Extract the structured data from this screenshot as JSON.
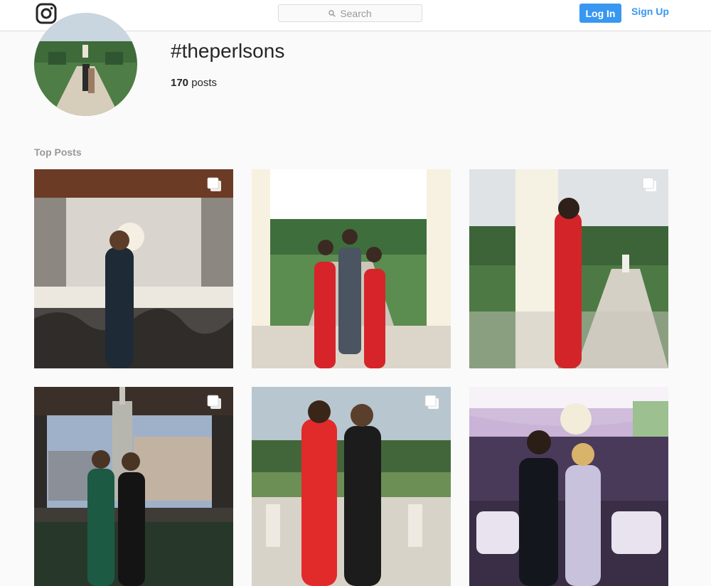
{
  "header": {
    "logo_icon": "instagram-glyph-icon",
    "search_placeholder": "Search",
    "search_icon": "magnifier-icon",
    "login_label": "Log In",
    "signup_label": "Sign Up",
    "accent_color": "#3897f0"
  },
  "profile": {
    "hashtag": "#theperlsons",
    "post_count": "170",
    "post_count_suffix": "posts"
  },
  "top_posts": {
    "title": "Top Posts",
    "posts": [
      {
        "alt": "Woman in black dress at chandelier balcony",
        "multi": true
      },
      {
        "alt": "Three people posing between flower pillars in garden",
        "multi": false
      },
      {
        "alt": "Woman in red dress beside flower column",
        "multi": true
      },
      {
        "alt": "Two women on rooftop at dusk",
        "multi": true
      },
      {
        "alt": "Two women in red and black dresses on terrace",
        "multi": true
      },
      {
        "alt": "Couple at reception under floral chandelier",
        "multi": false
      }
    ]
  }
}
